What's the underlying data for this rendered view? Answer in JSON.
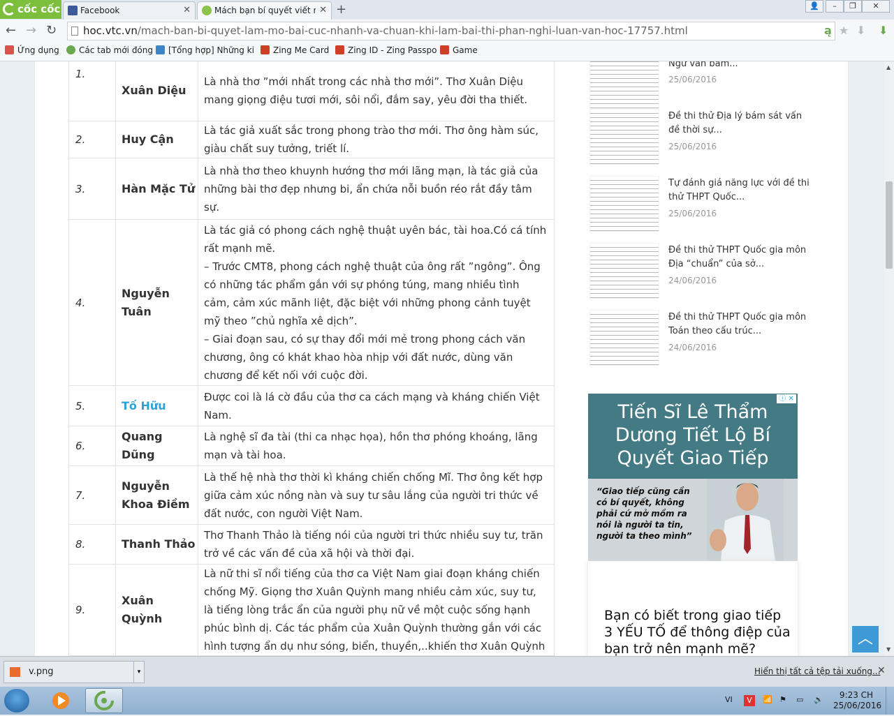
{
  "browser": {
    "brand": "cốc cốc",
    "tabs": [
      {
        "label": "Facebook",
        "active": false
      },
      {
        "label": "Mách bạn bí quyết viết mở",
        "active": true
      }
    ],
    "url_host": "hoc.vtc.vn",
    "url_path": "/mach-ban-bi-quyet-lam-mo-bai-cuc-nhanh-va-chuan-khi-lam-bai-thi-phan-nghi-luan-van-hoc-17757.html",
    "bookmarks": [
      {
        "label": "Ứng dụng",
        "color": "#d9534f"
      },
      {
        "label": "Các tab mới đóng",
        "color": "#6aa84f"
      },
      {
        "label": "[Tổng hợp] Những ki",
        "color": "#3d85c6"
      },
      {
        "label": "Zing Me Card",
        "color": "#cc4125"
      },
      {
        "label": "Zing ID - Zing Passpo",
        "color": "#cc4125"
      },
      {
        "label": "Game",
        "color": "#cc4125"
      }
    ]
  },
  "poets": [
    {
      "num": "1.",
      "name": "Xuân Diệu",
      "link": false,
      "desc": "Là nhà thơ ”mới nhất trong các nhà thơ mới”. Thơ Xuân Diệu mang giọng điệu tươi mới, sôi nổi, đắm say, yêu đời tha thiết."
    },
    {
      "num": "2.",
      "name": "Huy Cận",
      "link": false,
      "desc": "Là tác giả xuất sắc trong phong trào thơ mới. Thơ ông hàm súc, giàu chất suy tưởng, triết lí."
    },
    {
      "num": "3.",
      "name": "Hàn Mặc Tử",
      "link": false,
      "desc": "Là nhà thơ theo khuynh hướng thơ mới lãng mạn, là tác giả của những bài thơ đẹp nhưng bi, ẩn chứa nỗi buồn réo rắt đầy tâm sự."
    },
    {
      "num": "4.",
      "name": "Nguyễn Tuân",
      "link": false,
      "desc": " Là tác giả có phong cách nghệ thuật uyên bác, tài hoa.Có cá tính rất mạnh mẽ.\n– Trước CMT8, phong cách nghệ thuật của ông rất ”ngông”. Ông có những tác phẩm gắn với sự phóng túng, mang nhiều tình cảm, cảm xúc mãnh liệt, đặc biệt với những phong cảnh tuyệt mỹ theo ”chủ nghĩa xê dịch”.\n– Giai đoạn sau, có sự thay đổi mới mẻ trong phong cách văn chương, ông có khát khao hòa nhịp với đất nước, dùng văn chương để kết nối với cuộc đời."
    },
    {
      "num": "5.",
      "name": "Tố Hữu",
      "link": true,
      "desc": "Được coi là lá cờ đầu của thơ ca cách mạng và kháng chiến Việt Nam."
    },
    {
      "num": "6.",
      "name": "Quang Dũng",
      "link": false,
      "desc": "Là nghệ sĩ đa tài (thi ca nhạc họa), hồn thơ phóng khoáng, lãng mạn và tài hoa."
    },
    {
      "num": "7.",
      "name": "Nguyễn Khoa Điềm",
      "link": false,
      "desc": "Là thế hệ nhà thơ thời kì kháng chiến chống Mĩ. Thơ ông kết hợp giữa cảm xúc nồng nàn và suy tư sâu lắng của người tri thức về đất nước, con người Việt Nam."
    },
    {
      "num": "8.",
      "name": "Thanh Thảo",
      "link": false,
      "desc": "Thơ Thanh Thảo là tiếng nói của người tri thức nhiều suy tư, trăn trở về các vấn đề của xã hội và thời đại."
    },
    {
      "num": "9.",
      "name": "Xuân Quỳnh",
      "link": false,
      "desc": "Là nữ thi sĩ nổi tiếng của thơ ca Việt Nam giai đoạn kháng chiến chống Mỹ. Giọng thơ Xuân Quỳnh mang nhiều cảm xúc, suy tư, là tiếng lòng trắc ẩn của người phụ nữ về một cuộc sống hạnh phúc bình dị. Các tác phẩm của Xuân Quỳnh thường gắn với các hình tượng ẩn dụ như sóng, biển, thuyền,..khiến thơ Xuân Quỳnh"
    }
  ],
  "sidebar": [
    {
      "title": "Ngữ văn bám...",
      "date": "25/06/2016"
    },
    {
      "title": "Đề thi thử Địa lý bám sát vấn đề thời sự...",
      "date": "25/06/2016"
    },
    {
      "title": "Tự đánh giá năng lực với đề thi thử THPT Quốc...",
      "date": "25/06/2016"
    },
    {
      "title": "Đề thi thử THPT Quốc gia môn Địa “chuẩn” của sở...",
      "date": "24/06/2016"
    },
    {
      "title": "Đề thi thử THPT Quốc gia môn Toán theo cấu trúc...",
      "date": "24/06/2016"
    }
  ],
  "ad": {
    "headline": "Tiến Sĩ Lê Thẩm Dương Tiết Lộ Bí Quyết Giao Tiếp",
    "quote": "“Giao tiếp cũng cần có bí quyết, không phải cứ mở mồm ra nói là người ta tin, người ta theo mình”",
    "close_label": "ⓘ ✕"
  },
  "ad2": {
    "text": "Bạn có biết trong giao tiếp 3 YẾU TỐ để thông điệp của bạn trở nên mạnh mẽ?"
  },
  "download": {
    "filename": "v.png",
    "show_all": "Hiển thị tất cả tệp tải xuống..."
  },
  "taskbar": {
    "lang": "VI",
    "time": "9:23 CH",
    "date": "25/06/2016"
  }
}
